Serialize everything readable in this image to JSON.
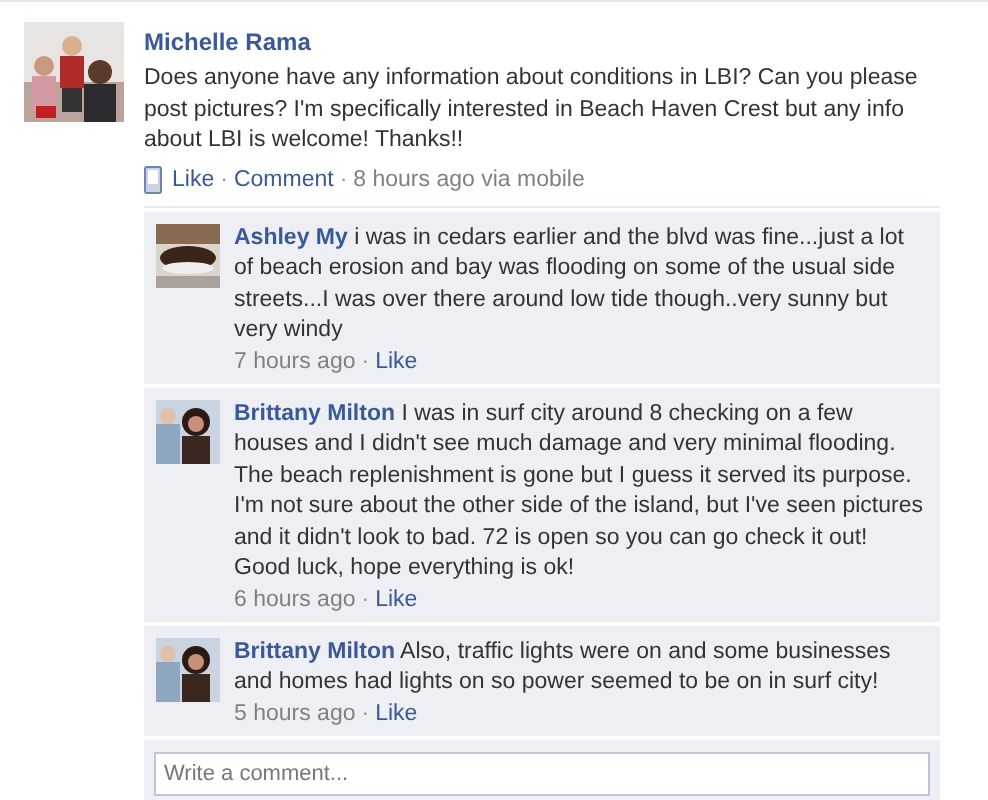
{
  "post": {
    "author": "Michelle Rama",
    "text": "Does anyone have any information about conditions in LBI? Can you please post pictures? I'm specifically interested in Beach Haven Crest but any info about LBI is welcome! Thanks!!",
    "actions": [
      "Like",
      "Comment"
    ],
    "time": "8 hours ago via mobile"
  },
  "comments": [
    {
      "author": "Ashley My",
      "text": "i was in cedars earlier and the blvd was fine...just a lot of beach erosion and bay was flooding on some of the usual side streets...I was over there around low tide though..very sunny but very windy",
      "time": "7 hours ago",
      "action": "Like"
    },
    {
      "author": "Brittany Milton",
      "text": "I was in surf city around 8 checking on a few houses and I didn't see much damage and very minimal flooding. The beach replenishment is gone but I guess it served its purpose. I'm not sure about the other side of the island, but I've seen pictures and it didn't look to bad. 72 is open so you can go check it out! Good luck, hope everything is ok!",
      "time": "6 hours ago",
      "action": "Like"
    },
    {
      "author": "Brittany Milton",
      "text": "Also, traffic lights were on and some businesses and homes had lights on so power seemed to be on in surf city!",
      "time": "5 hours ago",
      "action": "Like"
    }
  ],
  "separator": "·",
  "comment_field": {
    "placeholder": "Write a comment..."
  }
}
